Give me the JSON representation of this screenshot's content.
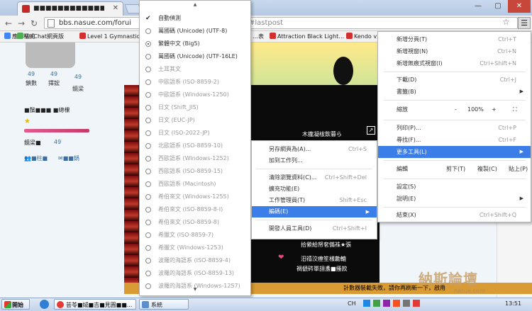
{
  "browser": {
    "tab_title": "■■■■■■■■■■■■■■■",
    "url_left": "bbs.nasue.com/forui",
    "url_right": "#lastpost"
  },
  "bookmarks": [
    {
      "label": "應用程式",
      "color": "#4285f4"
    },
    {
      "label": "WeChat網頁版",
      "color": "#4caf50"
    },
    {
      "label": "Level 1 Gymnastics",
      "color": "#d32f2f"
    }
  ],
  "bookmarks_right": [
    {
      "label": "…表",
      "color": "#888"
    },
    {
      "label": "Attraction Black Light…",
      "color": "#d32f2f"
    },
    {
      "label": "Kendo v…",
      "color": "#d32f2f"
    }
  ],
  "profile": {
    "stats": [
      {
        "value": "49",
        "label": "鎖數"
      },
      {
        "value": "49",
        "label": "擇鋐"
      },
      {
        "value": "49",
        "label": "鏡梁"
      }
    ],
    "rank_text": "■鬚■■■ ■總棵",
    "points_label": "鏡梁■",
    "points_value": "49",
    "link1": "■柱■",
    "link2": "■■鍋"
  },
  "banner_line": "木攏凝柭飲暮ら",
  "page_lines": [
    "拾縈給帑㚚慲祩★張",
    "汨禧洨瘗笙樣勷轆",
    "禂傂硶單翓盞■搔款"
  ],
  "bottom_text": "計數器裝載失敗，請你再刷新一下，啟用",
  "encoding_menu": {
    "scroll_up": "▲",
    "scroll_down": "▼",
    "items": [
      {
        "label": "自動偵測",
        "type": "check",
        "checked": true
      },
      {
        "label": "萬國碼 (Unicode) (UTF-8)",
        "type": "radio"
      },
      {
        "label": "繁體中文 (Big5)",
        "type": "radio",
        "selected": true
      },
      {
        "label": "萬國碼 (Unicode) (UTF-16LE)",
        "type": "radio"
      },
      {
        "label": "土耳其文",
        "type": "radio",
        "dim": true
      },
      {
        "label": "中歐語系 (ISO-8859-2)",
        "type": "radio",
        "dim": true
      },
      {
        "label": "中歐語系 (Windows-1250)",
        "type": "radio",
        "dim": true
      },
      {
        "label": "日文 (Shift_JIS)",
        "type": "radio",
        "dim": true
      },
      {
        "label": "日文 (EUC-JP)",
        "type": "radio",
        "dim": true
      },
      {
        "label": "日文 (ISO-2022-JP)",
        "type": "radio",
        "dim": true
      },
      {
        "label": "北歐語系 (ISO-8859-10)",
        "type": "radio",
        "dim": true
      },
      {
        "label": "西歐語系 (Windows-1252)",
        "type": "radio",
        "dim": true
      },
      {
        "label": "西歐語系 (ISO-8859-15)",
        "type": "radio",
        "dim": true
      },
      {
        "label": "西歐語系 (Macintosh)",
        "type": "radio",
        "dim": true
      },
      {
        "label": "希伯來文 (Windows-1255)",
        "type": "radio",
        "dim": true
      },
      {
        "label": "希伯來文 (ISO-8859-8-I)",
        "type": "radio",
        "dim": true
      },
      {
        "label": "希伯來文 (ISO-8859-8)",
        "type": "radio",
        "dim": true
      },
      {
        "label": "希臘文 (ISO-8859-7)",
        "type": "radio",
        "dim": true
      },
      {
        "label": "希臘文 (Windows-1253)",
        "type": "radio",
        "dim": true
      },
      {
        "label": "波羅的海語系 (ISO-8859-4)",
        "type": "radio",
        "dim": true
      },
      {
        "label": "波羅的海語系 (ISO-8859-13)",
        "type": "radio",
        "dim": true
      },
      {
        "label": "波羅的海語系 (Windows-1257)",
        "type": "radio",
        "dim": true
      }
    ]
  },
  "tools_submenu": {
    "items": [
      {
        "label": "另存網頁為(A)...",
        "shortcut": "Ctrl+S"
      },
      {
        "label": "加到工作列...",
        "shortcut": ""
      },
      {
        "sep": true
      },
      {
        "label": "清除瀏覽資料(C)...",
        "shortcut": "Ctrl+Shift+Del"
      },
      {
        "label": "擴充功能(E)",
        "shortcut": ""
      },
      {
        "label": "工作管理員(T)",
        "shortcut": "Shift+Esc"
      },
      {
        "label": "編碼(E)",
        "shortcut": "",
        "highlight": true,
        "arrow": "▶"
      },
      {
        "sep": true
      },
      {
        "label": "開發人員工具(D)",
        "shortcut": "Ctrl+Shift+I"
      }
    ]
  },
  "main_menu": {
    "new_tab": {
      "label": "新增分頁(T)",
      "shortcut": "Ctrl+T"
    },
    "new_window": {
      "label": "新增視窗(N)",
      "shortcut": "Ctrl+N"
    },
    "incognito": {
      "label": "新增無痕式視窗(I)",
      "shortcut": "Ctrl+Shift+N"
    },
    "downloads": {
      "label": "下載(D)",
      "shortcut": "Ctrl+J"
    },
    "bookmarks": {
      "label": "書籤(B)",
      "arrow": "▶"
    },
    "zoom": {
      "label": "縮放",
      "minus": "-",
      "value": "100%",
      "plus": "+",
      "full": "⛶"
    },
    "print": {
      "label": "列印(P)...",
      "shortcut": "Ctrl+P"
    },
    "find": {
      "label": "尋找(F)...",
      "shortcut": "Ctrl+F"
    },
    "more_tools": {
      "label": "更多工具(L)",
      "arrow": "▶"
    },
    "edit": {
      "label": "編輯",
      "cut": "剪下(T)",
      "copy": "複製(C)",
      "paste": "貼上(P)"
    },
    "settings": {
      "label": "設定(S)"
    },
    "help": {
      "label": "說明(E)",
      "arrow": "▶"
    },
    "exit": {
      "label": "結束(X)",
      "shortcut": "Ctrl+Shift+Q"
    }
  },
  "taskbar": {
    "start": "開始",
    "task1": "芸苓■娀■吉■見圓■■...",
    "task2": "系統",
    "lang": "CH",
    "time": "13:51"
  },
  "watermark": {
    "text": "納斯論壇",
    "url": "nasue.com"
  }
}
